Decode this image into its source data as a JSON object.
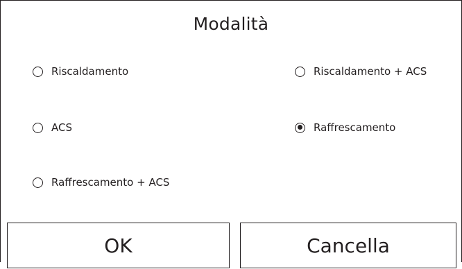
{
  "dialog": {
    "title": "Modalità"
  },
  "options": [
    {
      "label": "Riscaldamento",
      "selected": false
    },
    {
      "label": "Riscaldamento + ACS",
      "selected": false
    },
    {
      "label": "ACS",
      "selected": false
    },
    {
      "label": "Raffrescamento",
      "selected": true
    },
    {
      "label": "Raffrescamento + ACS",
      "selected": false
    }
  ],
  "buttons": {
    "ok_label": "OK",
    "cancel_label": "Cancella"
  }
}
